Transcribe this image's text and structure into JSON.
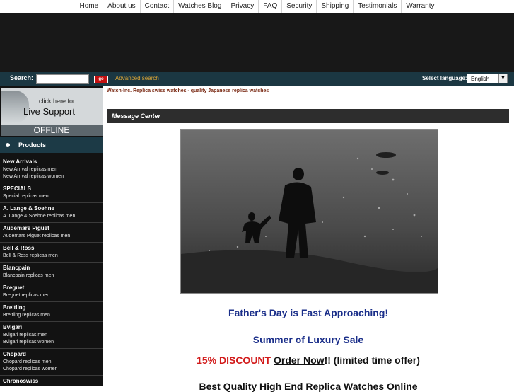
{
  "nav": [
    "Home",
    "About us",
    "Contact",
    "Watches Blog",
    "Privacy",
    "FAQ",
    "Security",
    "Shipping",
    "Testimonials",
    "Warranty"
  ],
  "search": {
    "label": "Search:",
    "value": "",
    "go_label": "go",
    "advanced_label": "Advanced search"
  },
  "language": {
    "label": "Select language:",
    "selected": "English"
  },
  "live_support": {
    "click_text": "click here for",
    "title": "Live Support",
    "status": "OFFLINE"
  },
  "products_label": "Products",
  "categories": [
    {
      "name": "New Arrivals",
      "subs": [
        "New Arrival replicas men",
        "New Arrival replicas women"
      ]
    },
    {
      "name": "SPECIALS",
      "subs": [
        "Special replicas men"
      ]
    },
    {
      "name": "A. Lange & Soehne",
      "subs": [
        "A. Lange & Soehne replicas men"
      ]
    },
    {
      "name": "Audemars Piguet",
      "subs": [
        "Audemars Piguet replicas men"
      ]
    },
    {
      "name": "Bell & Ross",
      "subs": [
        "Bell & Ross replicas men"
      ]
    },
    {
      "name": "Blancpain",
      "subs": [
        "Blancpain replicas men"
      ]
    },
    {
      "name": "Breguet",
      "subs": [
        "Breguet replicas men"
      ]
    },
    {
      "name": "Breitling",
      "subs": [
        "Breitling replicas men"
      ]
    },
    {
      "name": "Bvlgari",
      "subs": [
        "Bvlgari replicas men",
        "Bvlgari replicas women"
      ]
    },
    {
      "name": "Chopard",
      "subs": [
        "Chopard replicas men",
        "Chopard replicas women"
      ]
    },
    {
      "name": "Chronoswiss",
      "subs": []
    }
  ],
  "tagline": "Watch-Inc. Replica swiss watches - quality Japanese replica watches",
  "message_center": "Message Center",
  "promo": {
    "fathers_day": "Father's Day is Fast Approaching!",
    "summer_sale": "Summer of Luxury Sale",
    "discount": "15% DISCOUNT",
    "order_now": "Order Now",
    "limited": "!! (limited time offer)",
    "cut_line": "Best Quality High End Replica Watches Online"
  },
  "colors": {
    "search_bar": "#1b3742",
    "sidebar": "#121212",
    "heading_blue": "#1b2f8a",
    "discount_red": "#d21b1b",
    "tagline": "#7a2a14"
  }
}
